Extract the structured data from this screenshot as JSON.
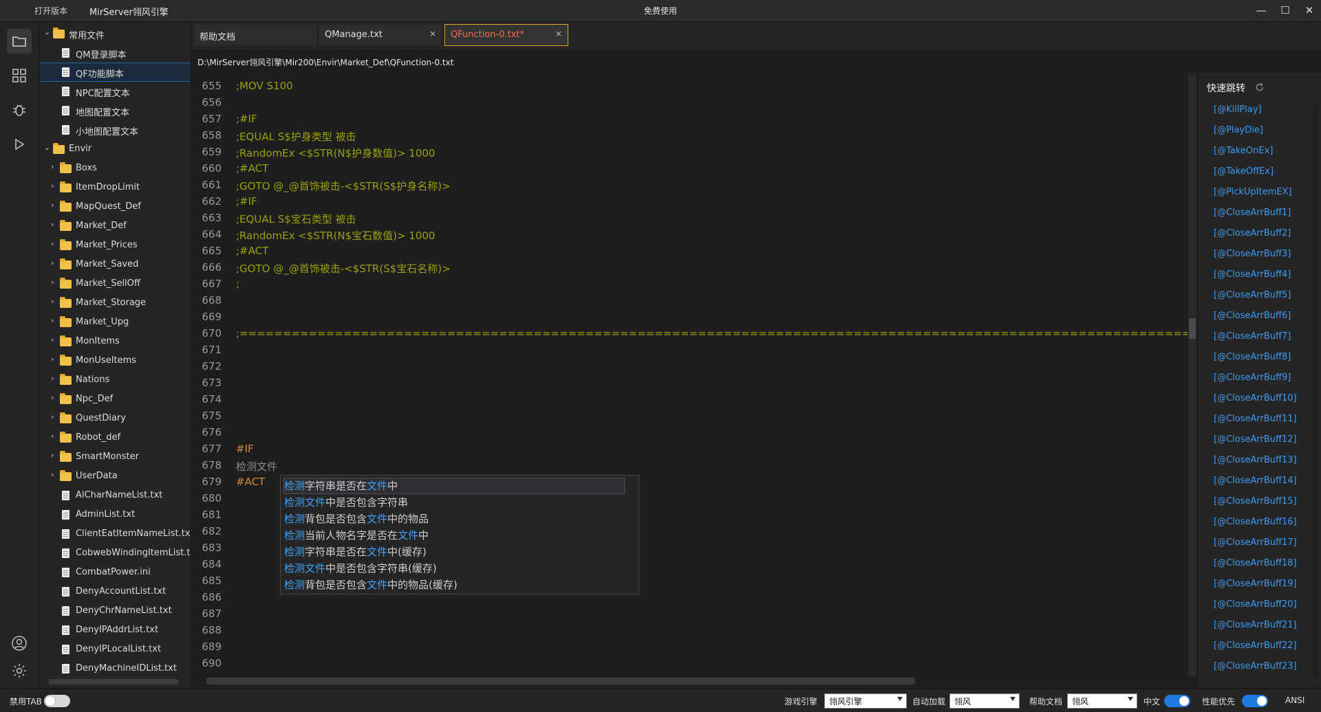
{
  "titlebar": {
    "open_version": "打开版本",
    "app_title": "MirServer翎风引擎",
    "center_text": "免费使用",
    "min_label": "—",
    "max_label": "☐",
    "close_label": "✕"
  },
  "explorer": {
    "items": [
      {
        "label": "常用文件",
        "kind": "folder",
        "depth": 0,
        "expanded": true
      },
      {
        "label": "QM登录脚本",
        "kind": "file",
        "depth": 1
      },
      {
        "label": "QF功能脚本",
        "kind": "file",
        "depth": 1,
        "selected": true
      },
      {
        "label": "NPC配置文本",
        "kind": "file",
        "depth": 1
      },
      {
        "label": "地图配置文本",
        "kind": "file",
        "depth": 1
      },
      {
        "label": "小地图配置文本",
        "kind": "file",
        "depth": 1
      },
      {
        "label": "Envir",
        "kind": "folder",
        "depth": 0,
        "expanded": true
      },
      {
        "label": "Boxs",
        "kind": "folder",
        "depth": 1
      },
      {
        "label": "ItemDropLimit",
        "kind": "folder",
        "depth": 1
      },
      {
        "label": "MapQuest_Def",
        "kind": "folder",
        "depth": 1
      },
      {
        "label": "Market_Def",
        "kind": "folder",
        "depth": 1
      },
      {
        "label": "Market_Prices",
        "kind": "folder",
        "depth": 1
      },
      {
        "label": "Market_Saved",
        "kind": "folder",
        "depth": 1
      },
      {
        "label": "Market_SellOff",
        "kind": "folder",
        "depth": 1
      },
      {
        "label": "Market_Storage",
        "kind": "folder",
        "depth": 1
      },
      {
        "label": "Market_Upg",
        "kind": "folder",
        "depth": 1
      },
      {
        "label": "MonItems",
        "kind": "folder",
        "depth": 1
      },
      {
        "label": "MonUseItems",
        "kind": "folder",
        "depth": 1
      },
      {
        "label": "Nations",
        "kind": "folder",
        "depth": 1
      },
      {
        "label": "Npc_Def",
        "kind": "folder",
        "depth": 1
      },
      {
        "label": "QuestDiary",
        "kind": "folder",
        "depth": 1
      },
      {
        "label": "Robot_def",
        "kind": "folder",
        "depth": 1
      },
      {
        "label": "SmartMonster",
        "kind": "folder",
        "depth": 1
      },
      {
        "label": "UserData",
        "kind": "folder",
        "depth": 1
      },
      {
        "label": "AlCharNameList.txt",
        "kind": "file",
        "depth": 1
      },
      {
        "label": "AdminList.txt",
        "kind": "file",
        "depth": 1
      },
      {
        "label": "ClientEatItemNameList.txt",
        "kind": "file",
        "depth": 1
      },
      {
        "label": "CobwebWindingItemList.t",
        "kind": "file",
        "depth": 1
      },
      {
        "label": "CombatPower.ini",
        "kind": "file",
        "depth": 1
      },
      {
        "label": "DenyAccountList.txt",
        "kind": "file",
        "depth": 1
      },
      {
        "label": "DenyChrNameList.txt",
        "kind": "file",
        "depth": 1
      },
      {
        "label": "DenyIPAddrList.txt",
        "kind": "file",
        "depth": 1
      },
      {
        "label": "DenyIPLocalList.txt",
        "kind": "file",
        "depth": 1
      },
      {
        "label": "DenyMachineIDList.txt",
        "kind": "file",
        "depth": 1
      }
    ]
  },
  "tabs": [
    {
      "label": "帮助文档",
      "closable": false,
      "active": false
    },
    {
      "label": "QManage.txt",
      "closable": true,
      "active": false
    },
    {
      "label": "QFunction-0.txt*",
      "closable": true,
      "active": true
    }
  ],
  "tab_close_glyph": "×",
  "path": "D:\\MirServer翎风引擎\\Mir200\\Envir\\Market_Def\\QFunction-0.txt",
  "editor": {
    "lines": [
      {
        "n": "655",
        "text": ";MOV S100",
        "cls": "c-comment"
      },
      {
        "n": "656",
        "text": "",
        "cls": ""
      },
      {
        "n": "657",
        "text": ";#IF",
        "cls": "c-comment"
      },
      {
        "n": "658",
        "text": ";EQUAL S$护身类型 被击",
        "cls": "c-comment"
      },
      {
        "n": "659",
        "text": ";RandomEx <$STR(N$护身数值)> 1000",
        "cls": "c-comment"
      },
      {
        "n": "660",
        "text": ";#ACT",
        "cls": "c-comment"
      },
      {
        "n": "661",
        "text": ";GOTO @_@首饰被击-<$STR(S$护身名称)>",
        "cls": "c-comment"
      },
      {
        "n": "662",
        "text": ";#IF",
        "cls": "c-comment"
      },
      {
        "n": "663",
        "text": ";EQUAL S$宝石类型 被击",
        "cls": "c-comment"
      },
      {
        "n": "664",
        "text": ";RandomEx <$STR(N$宝石数值)> 1000",
        "cls": "c-comment"
      },
      {
        "n": "665",
        "text": ";#ACT",
        "cls": "c-comment"
      },
      {
        "n": "666",
        "text": ";GOTO @_@首饰被击-<$STR(S$宝石名称)>",
        "cls": "c-comment"
      },
      {
        "n": "667",
        "text": ";",
        "cls": "c-comment"
      },
      {
        "n": "668",
        "text": "",
        "cls": ""
      },
      {
        "n": "669",
        "text": "",
        "cls": ""
      },
      {
        "n": "670",
        "text": ";==================================================================================================================",
        "cls": "c-comment"
      },
      {
        "n": "671",
        "text": "",
        "cls": ""
      },
      {
        "n": "672",
        "text": "",
        "cls": ""
      },
      {
        "n": "673",
        "text": "",
        "cls": ""
      },
      {
        "n": "674",
        "text": "",
        "cls": ""
      },
      {
        "n": "675",
        "text": "",
        "cls": ""
      },
      {
        "n": "676",
        "text": "",
        "cls": ""
      },
      {
        "n": "677",
        "text": "#IF",
        "cls": "c-kw"
      },
      {
        "n": "678",
        "text": "检测文件",
        "cls": "c-gray"
      },
      {
        "n": "679",
        "text": "#ACT",
        "cls": "c-kw"
      },
      {
        "n": "680",
        "text": "",
        "cls": ""
      },
      {
        "n": "681",
        "text": "",
        "cls": ""
      },
      {
        "n": "682",
        "text": "",
        "cls": ""
      },
      {
        "n": "683",
        "text": "",
        "cls": ""
      },
      {
        "n": "684",
        "text": "",
        "cls": ""
      },
      {
        "n": "685",
        "text": "",
        "cls": ""
      },
      {
        "n": "686",
        "text": "",
        "cls": ""
      },
      {
        "n": "687",
        "text": "",
        "cls": ""
      },
      {
        "n": "688",
        "text": "",
        "cls": ""
      },
      {
        "n": "689",
        "text": "",
        "cls": ""
      },
      {
        "n": "690",
        "text": "",
        "cls": ""
      }
    ]
  },
  "autocomplete": {
    "items": [
      [
        "检测",
        "字符串是否在",
        "文件",
        "中"
      ],
      [
        "检测",
        "",
        "文件",
        "中是否包含字符串"
      ],
      [
        "检测",
        "背包是否包含",
        "文件",
        "中的物品"
      ],
      [
        "检测",
        "当前人物名字是否在",
        "文件",
        "中"
      ],
      [
        "检测",
        "字符串是否在",
        "文件",
        "中(缓存)"
      ],
      [
        "检测",
        "",
        "文件",
        "中是否包含字符串(缓存)"
      ],
      [
        "检测",
        "背包是否包含",
        "文件",
        "中的物品(缓存)"
      ]
    ]
  },
  "quickjump": {
    "title": "快速跳转",
    "items": [
      "[@KillPlay]",
      "[@PlayDie]",
      "[@TakeOnEx]",
      "[@TakeOffEx]",
      "[@PickUpItemEX]",
      "[@CloseArrBuff1]",
      "[@CloseArrBuff2]",
      "[@CloseArrBuff3]",
      "[@CloseArrBuff4]",
      "[@CloseArrBuff5]",
      "[@CloseArrBuff6]",
      "[@CloseArrBuff7]",
      "[@CloseArrBuff8]",
      "[@CloseArrBuff9]",
      "[@CloseArrBuff10]",
      "[@CloseArrBuff11]",
      "[@CloseArrBuff12]",
      "[@CloseArrBuff13]",
      "[@CloseArrBuff14]",
      "[@CloseArrBuff15]",
      "[@CloseArrBuff16]",
      "[@CloseArrBuff17]",
      "[@CloseArrBuff18]",
      "[@CloseArrBuff19]",
      "[@CloseArrBuff20]",
      "[@CloseArrBuff21]",
      "[@CloseArrBuff22]",
      "[@CloseArrBuff23]"
    ]
  },
  "statusbar": {
    "disable_tab": "禁用TAB",
    "engine_label": "游戏引擎",
    "engine_value": "翎风引擎",
    "autoload_label": "自动加载",
    "autoload_value": "翎风",
    "help_label": "帮助文档",
    "help_value": "翎风",
    "chinese_label": "中文",
    "perf_label": "性能优先",
    "encoding": "ANSI"
  },
  "colors": {
    "accent": "#1f7ae0",
    "link": "#3a9bf2",
    "comment": "#9aa10c",
    "keyword": "#d7893b",
    "active_tab_text": "#ff6a4d"
  }
}
